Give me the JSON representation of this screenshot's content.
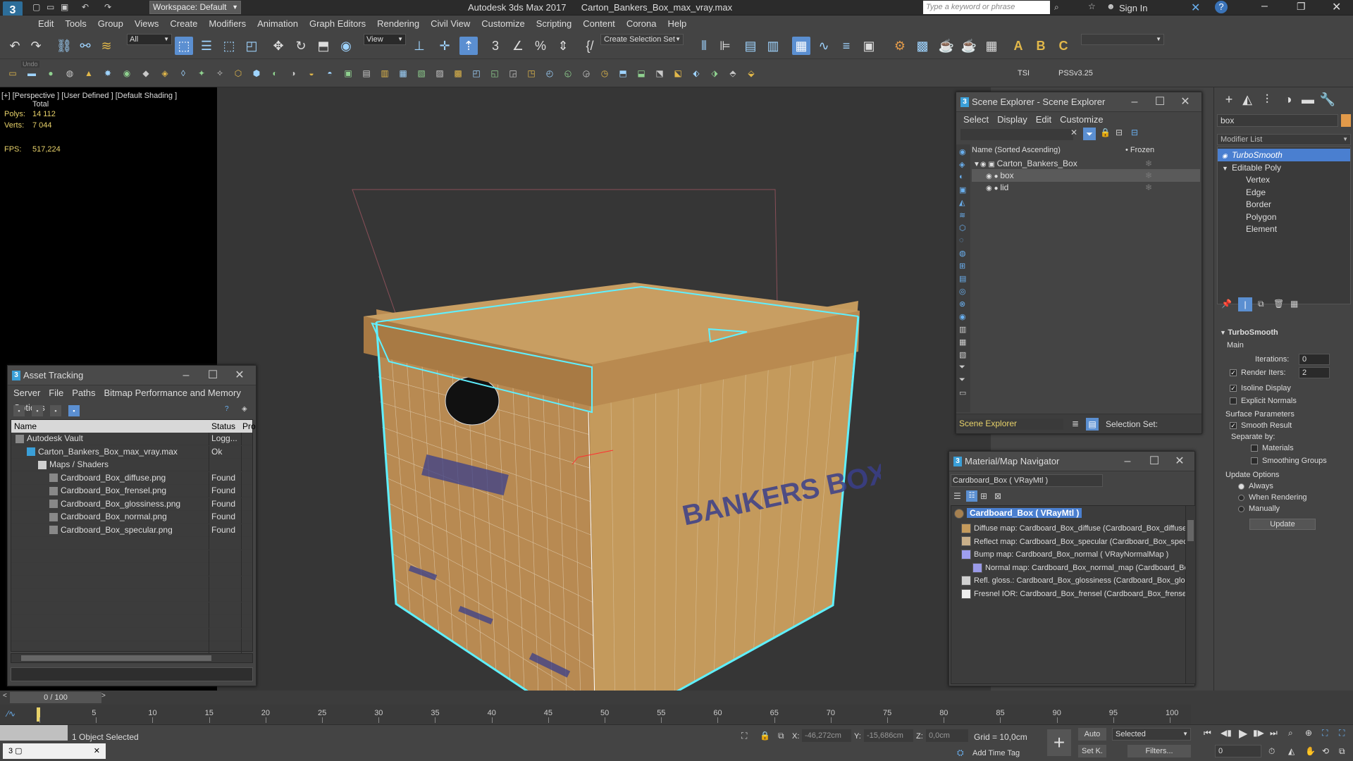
{
  "app": {
    "title": "Autodesk 3ds Max 2017",
    "filename": "Carton_Bankers_Box_max_vray.max",
    "workspace": "Workspace: Default",
    "search_placeholder": "Type a keyword or phrase",
    "sign_in": "Sign In"
  },
  "menu": [
    "Edit",
    "Tools",
    "Group",
    "Views",
    "Create",
    "Modifiers",
    "Animation",
    "Graph Editors",
    "Rendering",
    "Civil View",
    "Customize",
    "Scripting",
    "Content",
    "Corona",
    "Help"
  ],
  "toolbar": {
    "selection_filter": "All",
    "ref_coord": "View",
    "create_selection_set": "Create Selection Set",
    "tsi_label": "TSI",
    "pss_label": "PSSv3.25",
    "undo_tooltip": "Undo"
  },
  "viewport": {
    "label": "[+] [Perspective ] [User Defined ] [Default Shading ]",
    "stats_header": "Total",
    "polys_label": "Polys:",
    "polys_value": "14 112",
    "verts_label": "Verts:",
    "verts_value": "7 044",
    "fps_label": "FPS:",
    "fps_value": "517,224",
    "box_print_side": "BANKERS BOX"
  },
  "asset_tracking": {
    "title": "Asset Tracking",
    "menu": [
      "Server",
      "File",
      "Paths",
      "Bitmap Performance and Memory",
      "Options"
    ],
    "columns": [
      "Name",
      "Status",
      "Pro"
    ],
    "rows": [
      {
        "name": "Autodesk Vault",
        "status": "Logg...",
        "indent": 0
      },
      {
        "name": "Carton_Bankers_Box_max_vray.max",
        "status": "Ok",
        "indent": 1
      },
      {
        "name": "Maps / Shaders",
        "status": "",
        "indent": 2
      },
      {
        "name": "Cardboard_Box_diffuse.png",
        "status": "Found",
        "indent": 3
      },
      {
        "name": "Cardboard_Box_frensel.png",
        "status": "Found",
        "indent": 3
      },
      {
        "name": "Cardboard_Box_glossiness.png",
        "status": "Found",
        "indent": 3
      },
      {
        "name": "Cardboard_Box_normal.png",
        "status": "Found",
        "indent": 3
      },
      {
        "name": "Cardboard_Box_specular.png",
        "status": "Found",
        "indent": 3
      }
    ]
  },
  "scene_explorer": {
    "title": "Scene Explorer - Scene Explorer",
    "menu": [
      "Select",
      "Display",
      "Edit",
      "Customize"
    ],
    "col_name": "Name (Sorted Ascending)",
    "col_frozen": "• Frozen",
    "tree": [
      {
        "name": "Carton_Bankers_Box",
        "indent": 0
      },
      {
        "name": "box",
        "indent": 1,
        "selected": true
      },
      {
        "name": "lid",
        "indent": 1
      }
    ],
    "footer_label": "Scene Explorer",
    "selection_set_label": "Selection Set:"
  },
  "material_nav": {
    "title": "Material/Map Navigator",
    "current": "Cardboard_Box  ( VRayMtl )",
    "root": "Cardboard_Box  ( VRayMtl )",
    "items": [
      {
        "text": "Diffuse map: Cardboard_Box_diffuse (Cardboard_Box_diffuse",
        "color": "#c49a5c"
      },
      {
        "text": "Reflect map: Cardboard_Box_specular (Cardboard_Box_specu",
        "color": "#c9b08a"
      },
      {
        "text": "Bump map: Cardboard_Box_normal  ( VRayNormalMap )",
        "color": "#9f9ff0"
      },
      {
        "text": "Normal map: Cardboard_Box_normal_map (Cardboard_Box",
        "color": "#9a9ae8",
        "sub": true
      },
      {
        "text": "Refl. gloss.: Cardboard_Box_glossiness (Cardboard_Box_glos",
        "color": "#cfcfcf"
      },
      {
        "text": "Fresnel IOR: Cardboard_Box_frensel (Cardboard_Box_frensel",
        "color": "#eeeeee"
      }
    ]
  },
  "command_panel": {
    "object_name": "box",
    "modifier_list": "Modifier List",
    "stack": [
      {
        "name": "TurboSmooth",
        "level": 0,
        "active": true
      },
      {
        "name": "Editable Poly",
        "level": 0
      },
      {
        "name": "Vertex",
        "level": 1
      },
      {
        "name": "Edge",
        "level": 1
      },
      {
        "name": "Border",
        "level": 1
      },
      {
        "name": "Polygon",
        "level": 1
      },
      {
        "name": "Element",
        "level": 1
      }
    ],
    "rollout_title": "TurboSmooth",
    "main_label": "Main",
    "iterations_label": "Iterations:",
    "iterations_value": "0",
    "render_iters_label": "Render Iters:",
    "render_iters_value": "2",
    "isoline_label": "Isoline Display",
    "explicit_normals_label": "Explicit Normals",
    "surface_params_label": "Surface Parameters",
    "smooth_result_label": "Smooth Result",
    "separate_by_label": "Separate by:",
    "materials_label": "Materials",
    "smoothing_groups_label": "Smoothing Groups",
    "update_options_label": "Update Options",
    "always_label": "Always",
    "when_rendering_label": "When Rendering",
    "manually_label": "Manually",
    "update_button": "Update"
  },
  "timeline": {
    "frame_display": "0 / 100",
    "ticks": [
      "0",
      "5",
      "10",
      "15",
      "20",
      "25",
      "30",
      "35",
      "40",
      "45",
      "50",
      "55",
      "60",
      "65",
      "70",
      "75",
      "80",
      "85",
      "90",
      "95",
      "100"
    ]
  },
  "status": {
    "selection_text": "1 Object Selected",
    "x_label": "X:",
    "x_value": "-46,272cm",
    "y_label": "Y:",
    "y_value": "-15,686cm",
    "z_label": "Z:",
    "z_value": "0,0cm",
    "grid_text": "Grid = 10,0cm",
    "add_time_tag": "Add Time Tag",
    "auto_label": "Auto",
    "set_k_label": "Set K.",
    "selected_dropdown": "Selected",
    "filters_label": "Filters...",
    "frame_spinner": "0"
  },
  "colors": {
    "accent": "#3a9fd8",
    "selection_highlight": "#4a7fd0",
    "box_wire": "#5ff0ff",
    "cardboard": "#c49a5c"
  }
}
